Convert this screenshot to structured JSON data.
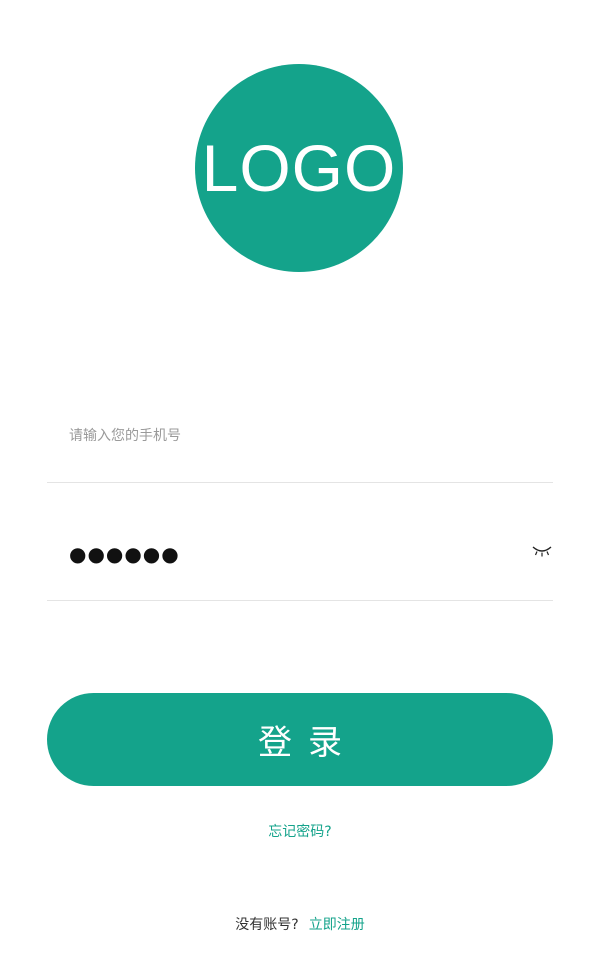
{
  "logo": {
    "text": "LOGO"
  },
  "phone_field": {
    "placeholder": "请输入您的手机号",
    "value": ""
  },
  "password_field": {
    "value": "●●●●●●",
    "toggle_icon": "eye-closed-icon"
  },
  "login_button": {
    "label": "登录"
  },
  "forgot_password": {
    "label": "忘记密码?"
  },
  "register": {
    "prompt": "没有账号?",
    "link_label": "立即注册"
  },
  "colors": {
    "accent": "#14a38b",
    "divider": "#e4e4e4",
    "placeholder": "#9a9a9a",
    "text": "#333333"
  }
}
